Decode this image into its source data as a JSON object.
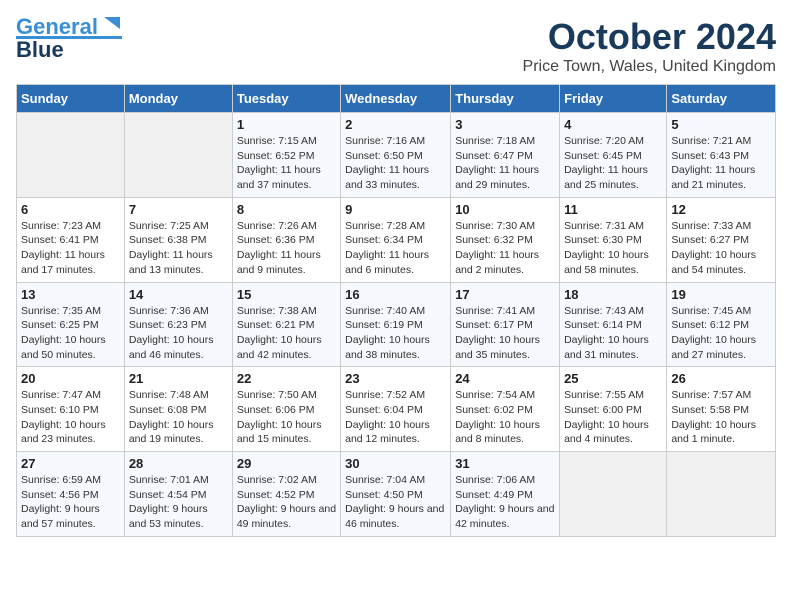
{
  "logo": {
    "line1": "General",
    "line2": "Blue"
  },
  "title": "October 2024",
  "subtitle": "Price Town, Wales, United Kingdom",
  "days_of_week": [
    "Sunday",
    "Monday",
    "Tuesday",
    "Wednesday",
    "Thursday",
    "Friday",
    "Saturday"
  ],
  "weeks": [
    [
      {
        "day": "",
        "info": ""
      },
      {
        "day": "",
        "info": ""
      },
      {
        "day": "1",
        "info": "Sunrise: 7:15 AM\nSunset: 6:52 PM\nDaylight: 11 hours and 37 minutes."
      },
      {
        "day": "2",
        "info": "Sunrise: 7:16 AM\nSunset: 6:50 PM\nDaylight: 11 hours and 33 minutes."
      },
      {
        "day": "3",
        "info": "Sunrise: 7:18 AM\nSunset: 6:47 PM\nDaylight: 11 hours and 29 minutes."
      },
      {
        "day": "4",
        "info": "Sunrise: 7:20 AM\nSunset: 6:45 PM\nDaylight: 11 hours and 25 minutes."
      },
      {
        "day": "5",
        "info": "Sunrise: 7:21 AM\nSunset: 6:43 PM\nDaylight: 11 hours and 21 minutes."
      }
    ],
    [
      {
        "day": "6",
        "info": "Sunrise: 7:23 AM\nSunset: 6:41 PM\nDaylight: 11 hours and 17 minutes."
      },
      {
        "day": "7",
        "info": "Sunrise: 7:25 AM\nSunset: 6:38 PM\nDaylight: 11 hours and 13 minutes."
      },
      {
        "day": "8",
        "info": "Sunrise: 7:26 AM\nSunset: 6:36 PM\nDaylight: 11 hours and 9 minutes."
      },
      {
        "day": "9",
        "info": "Sunrise: 7:28 AM\nSunset: 6:34 PM\nDaylight: 11 hours and 6 minutes."
      },
      {
        "day": "10",
        "info": "Sunrise: 7:30 AM\nSunset: 6:32 PM\nDaylight: 11 hours and 2 minutes."
      },
      {
        "day": "11",
        "info": "Sunrise: 7:31 AM\nSunset: 6:30 PM\nDaylight: 10 hours and 58 minutes."
      },
      {
        "day": "12",
        "info": "Sunrise: 7:33 AM\nSunset: 6:27 PM\nDaylight: 10 hours and 54 minutes."
      }
    ],
    [
      {
        "day": "13",
        "info": "Sunrise: 7:35 AM\nSunset: 6:25 PM\nDaylight: 10 hours and 50 minutes."
      },
      {
        "day": "14",
        "info": "Sunrise: 7:36 AM\nSunset: 6:23 PM\nDaylight: 10 hours and 46 minutes."
      },
      {
        "day": "15",
        "info": "Sunrise: 7:38 AM\nSunset: 6:21 PM\nDaylight: 10 hours and 42 minutes."
      },
      {
        "day": "16",
        "info": "Sunrise: 7:40 AM\nSunset: 6:19 PM\nDaylight: 10 hours and 38 minutes."
      },
      {
        "day": "17",
        "info": "Sunrise: 7:41 AM\nSunset: 6:17 PM\nDaylight: 10 hours and 35 minutes."
      },
      {
        "day": "18",
        "info": "Sunrise: 7:43 AM\nSunset: 6:14 PM\nDaylight: 10 hours and 31 minutes."
      },
      {
        "day": "19",
        "info": "Sunrise: 7:45 AM\nSunset: 6:12 PM\nDaylight: 10 hours and 27 minutes."
      }
    ],
    [
      {
        "day": "20",
        "info": "Sunrise: 7:47 AM\nSunset: 6:10 PM\nDaylight: 10 hours and 23 minutes."
      },
      {
        "day": "21",
        "info": "Sunrise: 7:48 AM\nSunset: 6:08 PM\nDaylight: 10 hours and 19 minutes."
      },
      {
        "day": "22",
        "info": "Sunrise: 7:50 AM\nSunset: 6:06 PM\nDaylight: 10 hours and 15 minutes."
      },
      {
        "day": "23",
        "info": "Sunrise: 7:52 AM\nSunset: 6:04 PM\nDaylight: 10 hours and 12 minutes."
      },
      {
        "day": "24",
        "info": "Sunrise: 7:54 AM\nSunset: 6:02 PM\nDaylight: 10 hours and 8 minutes."
      },
      {
        "day": "25",
        "info": "Sunrise: 7:55 AM\nSunset: 6:00 PM\nDaylight: 10 hours and 4 minutes."
      },
      {
        "day": "26",
        "info": "Sunrise: 7:57 AM\nSunset: 5:58 PM\nDaylight: 10 hours and 1 minute."
      }
    ],
    [
      {
        "day": "27",
        "info": "Sunrise: 6:59 AM\nSunset: 4:56 PM\nDaylight: 9 hours and 57 minutes."
      },
      {
        "day": "28",
        "info": "Sunrise: 7:01 AM\nSunset: 4:54 PM\nDaylight: 9 hours and 53 minutes."
      },
      {
        "day": "29",
        "info": "Sunrise: 7:02 AM\nSunset: 4:52 PM\nDaylight: 9 hours and 49 minutes."
      },
      {
        "day": "30",
        "info": "Sunrise: 7:04 AM\nSunset: 4:50 PM\nDaylight: 9 hours and 46 minutes."
      },
      {
        "day": "31",
        "info": "Sunrise: 7:06 AM\nSunset: 4:49 PM\nDaylight: 9 hours and 42 minutes."
      },
      {
        "day": "",
        "info": ""
      },
      {
        "day": "",
        "info": ""
      }
    ]
  ]
}
